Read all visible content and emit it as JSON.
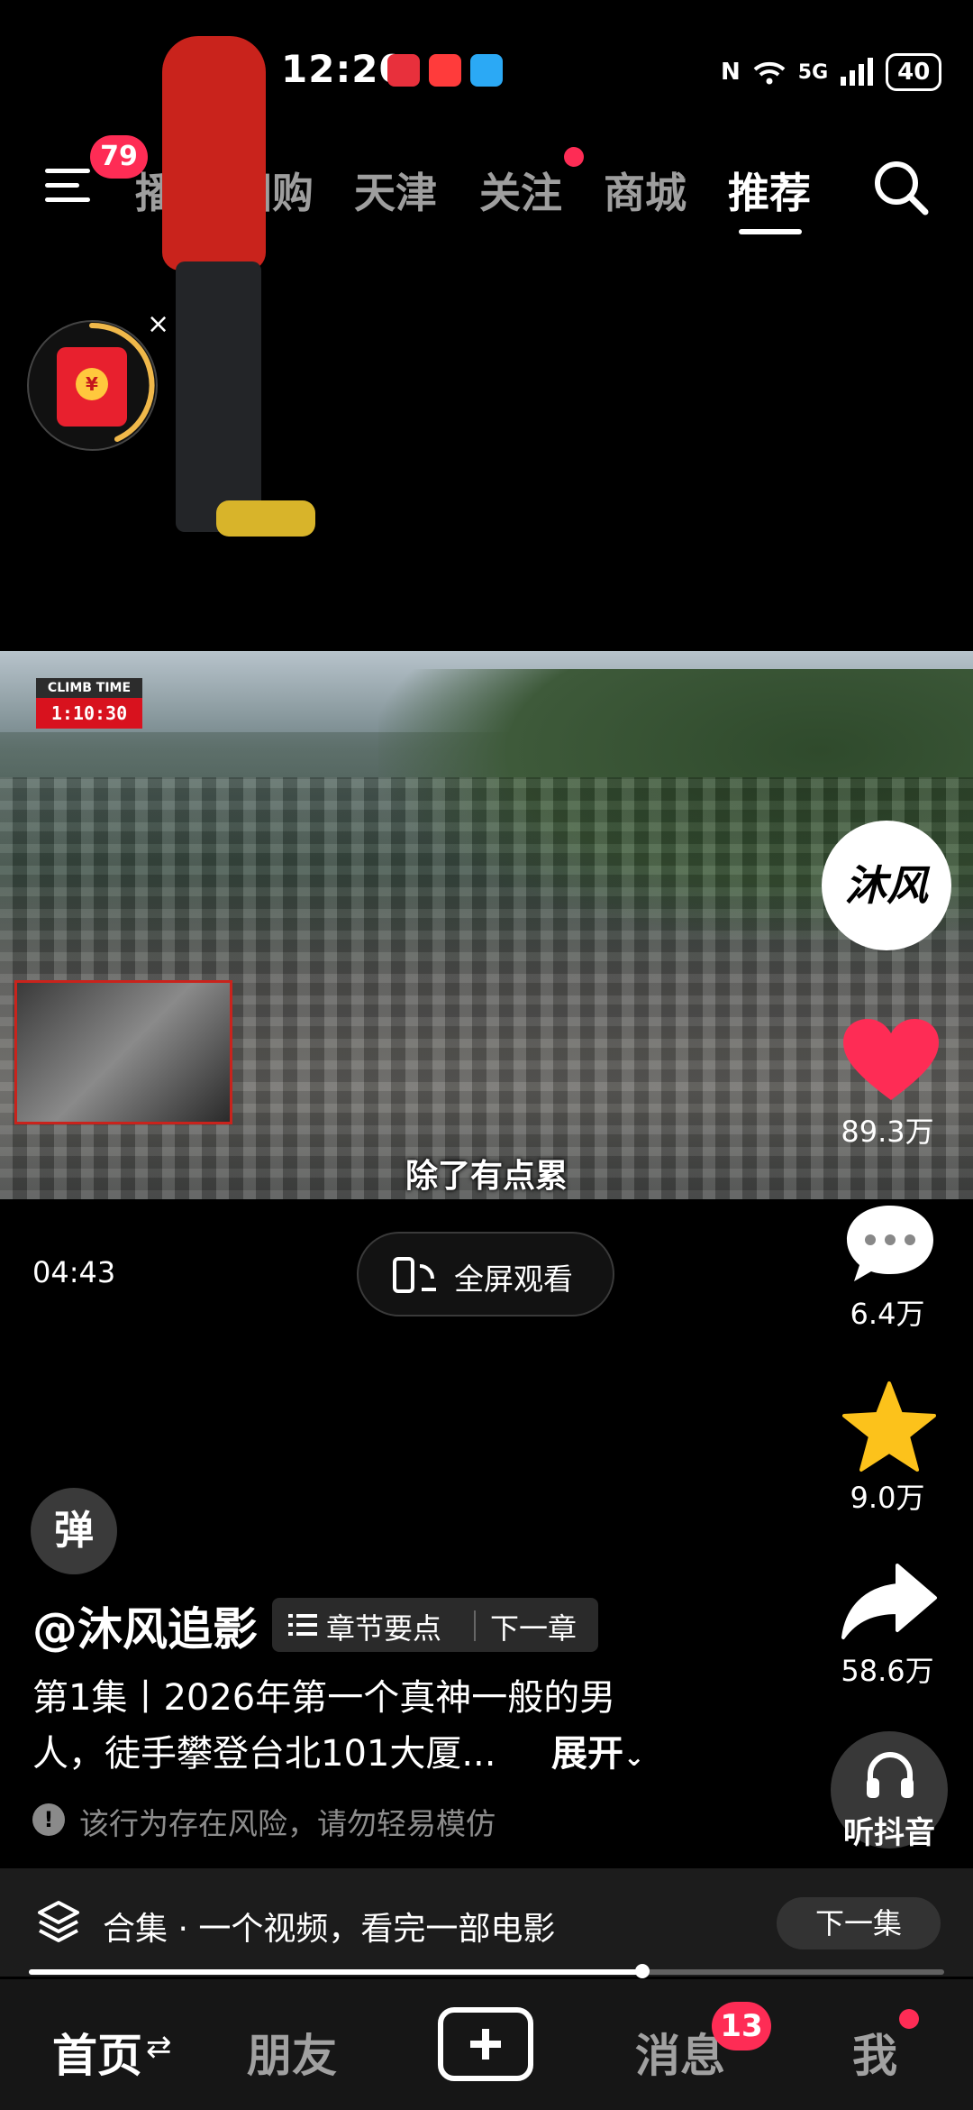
{
  "status_bar": {
    "time": "12:20",
    "network": "5G",
    "battery": "40"
  },
  "top_nav": {
    "menu_badge": "79",
    "tabs": [
      {
        "label": "播",
        "active": false
      },
      {
        "label": "团购",
        "active": false
      },
      {
        "label": "天津",
        "active": false
      },
      {
        "label": "关注",
        "active": false,
        "dot": true
      },
      {
        "label": "商城",
        "active": false
      },
      {
        "label": "推荐",
        "active": true
      }
    ]
  },
  "red_packet": {
    "coin_symbol": "¥",
    "close": "×"
  },
  "video": {
    "timer_label": "CLIMB TIME",
    "timer_value": "1:10:30",
    "subtitle": "除了有点累",
    "duration": "04:43",
    "fullscreen_label": "全屏观看"
  },
  "right_rail": {
    "avatar_text": "沐风",
    "likes": "89.3万",
    "comments": "6.4万",
    "favorites": "9.0万",
    "shares": "58.6万",
    "listen_label": "听抖音"
  },
  "info": {
    "danmu": "弹",
    "author": "@沐风追影",
    "chapter_label": "章节要点",
    "next_chapter": "下一章",
    "desc_line1": "第1集丨2026年第一个真神一般的男",
    "desc_line2": "人，徒手攀登台北101大厦...",
    "expand": "展开",
    "warning": "该行为存在风险，请勿轻易模仿"
  },
  "collection": {
    "label": "合集 · 一个视频，看完一部电影",
    "next_episode": "下一集",
    "progress": 0.67
  },
  "bottom_nav": {
    "home": "首页",
    "friends": "朋友",
    "messages": "消息",
    "messages_badge": "13",
    "me": "我"
  },
  "colors": {
    "accent": "#fe2c55",
    "background": "#000000"
  }
}
